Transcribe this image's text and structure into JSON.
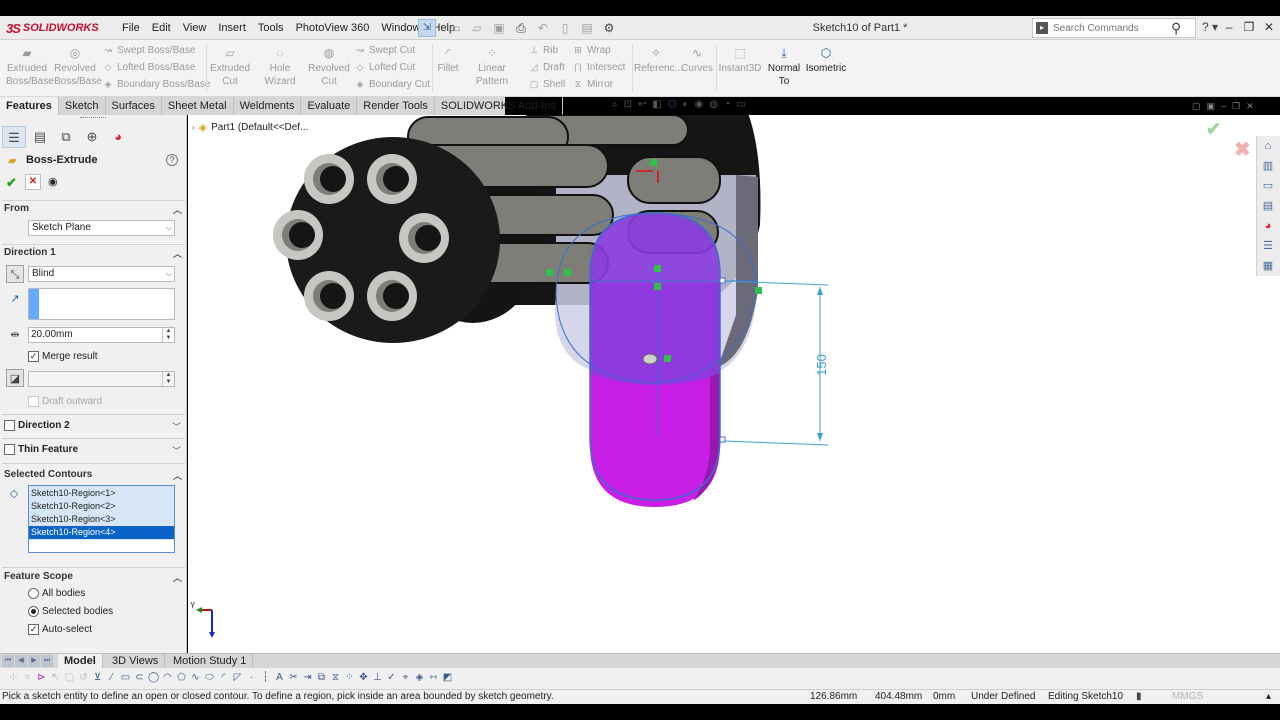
{
  "app": {
    "logo_ds": "3S",
    "logo_name": "SOLIDWORKS",
    "menu": [
      "File",
      "Edit",
      "View",
      "Insert",
      "Tools",
      "PhotoView 360",
      "Window",
      "Help"
    ],
    "document_title": "Sketch10 of Part1 *",
    "search_placeholder": "Search Commands",
    "help_symbol": "?"
  },
  "commands": {
    "extruded_boss_l1": "Extruded",
    "extruded_boss_l2": "Boss/Base",
    "revolved_boss_l1": "Revolved",
    "revolved_boss_l2": "Boss/Base",
    "swept_boss": "Swept Boss/Base",
    "lofted_boss": "Lofted Boss/Base",
    "boundary_boss": "Boundary Boss/Base",
    "extruded_cut_l1": "Extruded",
    "extruded_cut_l2": "Cut",
    "hole_wizard": "Hole Wizard",
    "revolved_cut_l1": "Revolved",
    "revolved_cut_l2": "Cut",
    "swept_cut": "Swept Cut",
    "lofted_cut": "Lofted Cut",
    "boundary_cut": "Boundary Cut",
    "fillet": "Fillet",
    "linear_pattern": "Linear Pattern",
    "rib": "Rib",
    "draft": "Draft",
    "shell": "Shell",
    "wrap": "Wrap",
    "intersect": "Intersect",
    "mirror": "Mirror",
    "reference": "Referenc...",
    "curves": "Curves",
    "instant3d": "Instant3D",
    "normal_to_l1": "Normal",
    "normal_to_l2": "To",
    "isometric": "Isometric"
  },
  "tabs": [
    "Features",
    "Sketch",
    "Surfaces",
    "Sheet Metal",
    "Weldments",
    "Evaluate",
    "Render Tools",
    "SOLIDWORKS Add-Ins"
  ],
  "property_manager": {
    "title": "Boss-Extrude",
    "help": "?",
    "from_label": "From",
    "from_value": "Sketch Plane",
    "direction1_label": "Direction 1",
    "end_condition": "Blind",
    "depth": "20.00mm",
    "merge_result": "Merge result",
    "merge_checked": true,
    "draft_outward": "Draft outward",
    "direction2_label": "Direction 2",
    "thin_feature_label": "Thin Feature",
    "selected_contours_label": "Selected Contours",
    "contours": [
      {
        "label": "Sketch10-Region<1>",
        "selected": false
      },
      {
        "label": "Sketch10-Region<2>",
        "selected": false
      },
      {
        "label": "Sketch10-Region<3>",
        "selected": false
      },
      {
        "label": "Sketch10-Region<4>",
        "selected": true
      }
    ],
    "feature_scope_label": "Feature Scope",
    "all_bodies": "All bodies",
    "selected_bodies": "Selected bodies",
    "auto_select": "Auto-select",
    "scope_selected": "selected_bodies"
  },
  "viewport": {
    "breadcrumb": "Part1  (Default<<Def...",
    "dimension": "150",
    "triad_y": "Y"
  },
  "colors": {
    "extrude_preview": "#c81ee6",
    "sketch_region": "#8a3ce0",
    "sketch_line": "#3c6ecc",
    "dimension": "#3aa0d8",
    "body_dark": "#1a1a1a",
    "barrel_grey": "#7f7d78",
    "confirm_green": "#21a321",
    "cancel_red": "#d02020"
  },
  "bottom_tabs": [
    "Model",
    "3D Views",
    "Motion Study 1"
  ],
  "status": {
    "message": "Pick a sketch entity to define an open or closed contour. To define a region, pick inside an area bounded by sketch geometry.",
    "x": "126.86mm",
    "y": "404.48mm",
    "z": "0mm",
    "state": "Under Defined",
    "editing": "Editing Sketch10",
    "units": "MMGS"
  }
}
